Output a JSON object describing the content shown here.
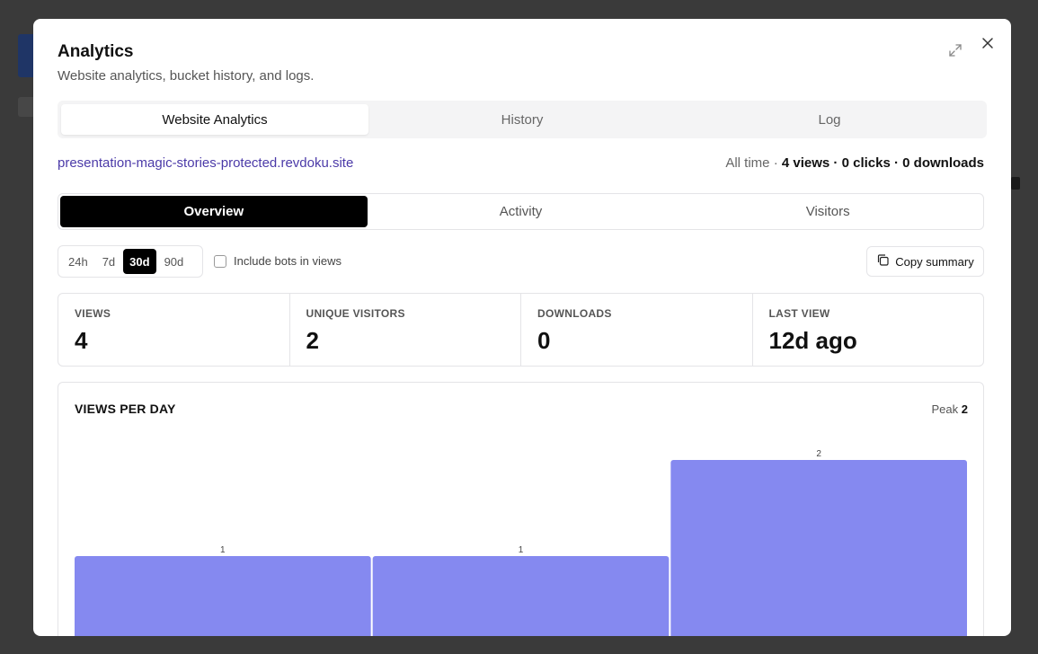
{
  "modal": {
    "title": "Analytics",
    "subtitle": "Website analytics, bucket history, and logs."
  },
  "main_tabs": [
    {
      "label": "Website Analytics",
      "active": true
    },
    {
      "label": "History",
      "active": false
    },
    {
      "label": "Log",
      "active": false
    }
  ],
  "site": {
    "url": "presentation-magic-stories-protected.revdoku.site",
    "period_label": "All time",
    "views_summary": "4 views",
    "clicks_summary": "0 clicks",
    "downloads_summary": "0 downloads"
  },
  "sub_tabs": [
    {
      "label": "Overview",
      "active": true
    },
    {
      "label": "Activity",
      "active": false
    },
    {
      "label": "Visitors",
      "active": false
    }
  ],
  "ranges": [
    {
      "label": "24h",
      "active": false
    },
    {
      "label": "7d",
      "active": false
    },
    {
      "label": "30d",
      "active": true
    },
    {
      "label": "90d",
      "active": false
    }
  ],
  "bots_label": "Include bots in views",
  "copy_label": "Copy summary",
  "stats": [
    {
      "label": "VIEWS",
      "value": "4"
    },
    {
      "label": "UNIQUE VISITORS",
      "value": "2"
    },
    {
      "label": "DOWNLOADS",
      "value": "0"
    },
    {
      "label": "LAST VIEW",
      "value": "12d ago"
    }
  ],
  "colors": {
    "accent_link": "#4b3aa8",
    "bar": "#8589f0",
    "active_tab": "#000000"
  },
  "chart_data": {
    "type": "bar",
    "title": "VIEWS PER DAY",
    "peak_label": "Peak",
    "peak_value": "2",
    "categories": [],
    "values": [
      1,
      1,
      2
    ],
    "ylim": [
      0,
      2
    ],
    "grid": false,
    "legend": "none"
  }
}
